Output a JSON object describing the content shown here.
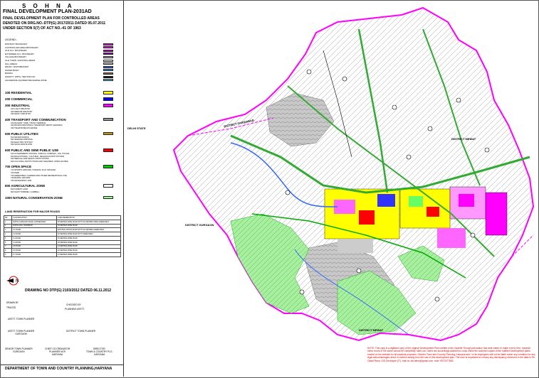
{
  "title": {
    "name": "S O H N A",
    "plan": "FINAL DEVELOPMENT PLAN-2031AD",
    "line1": "FINAL DEVELOPMENT PLAN FOR CONTROLLED AREAS",
    "line2": "DENOTED ON DRG.NO.-DTP(G) 2017/2011 DATED 05.07.2011",
    "line3": "UNDER SECTION 5(7) OF ACT NO.-41 OF 1963"
  },
  "legend": {
    "heading": "LEGEND:-",
    "boundaries": [
      {
        "label": "DISTRICT BOUNDARY",
        "color": "#ff00ff"
      },
      {
        "label": "CONTROLLED AREA BOUNDARY",
        "color": "#ff00ff"
      },
      {
        "label": "OLD M.C. BOUNDARY",
        "color": "#cc00cc"
      },
      {
        "label": "EXTENDED M.C. BOUNDARY",
        "color": "#9900cc"
      },
      {
        "label": "VILLAGE BOUNDARY",
        "color": "#aaaaaa"
      },
      {
        "label": "OLD TOWN / EXISTING ABADI",
        "color": "#ffffff"
      },
      {
        "label": "HILL AREAS",
        "color": "#cfcfcf"
      },
      {
        "label": "DRAIN / DISTRIBUTARY",
        "color": "#3366ff"
      },
      {
        "label": "WATER BODY",
        "color": "#3399ff"
      },
      {
        "label": "BUNDH",
        "color": "#996633"
      },
      {
        "label": "GRAVITY (PPS) / SECTOR NO.",
        "color": "#000000"
      },
      {
        "label": "AGGRESIVE AQUIFER RECHARGE ZONE",
        "color": "#66ccff"
      }
    ],
    "zones": [
      {
        "label": "100  RESIDENTIAL",
        "color": "#ffff00",
        "subs": []
      },
      {
        "label": "200  COMMERCIAL",
        "color": "#0000ff",
        "subs": []
      },
      {
        "label": "300  INDUSTRIAL",
        "color": "#ff00ff",
        "subs": [
          "310  LIGHT INDUSTRY",
          "320  MEDIUM INDUSTRY",
          "330  HEAVY INDUSTRY"
        ]
      },
      {
        "label": "400  TRANSPORT AND COMMUNICATION",
        "color": "#999999",
        "subs": [
          "410  RAILWAY YARD, TRUCK TERMINAL",
          "420  ROADS INDUSTRIAL TRANSPORT DEPOT (HEAVIES)",
          "430  TELEPHONE EXCHANGE"
        ]
      },
      {
        "label": "500  PUBLIC UTILITIES",
        "color": "#cc9900",
        "subs": [
          "510  WATER WORKS",
          "520  SEWAGE DISPOSAL",
          "530  ELECTRIC STATION",
          "540  SOLID WASTE SITE"
        ]
      },
      {
        "label": "600  PUBLIC AND SEMI PUBLIC USE",
        "color": "#ff0000",
        "subs": [
          "610  GOVERNMENT OFFICES, JUDICIAL COMPLEX, JAIL, POLICE",
          "620  EDUCATIONAL, CULTURAL, RELIGIOUS INSTITUTIONS",
          "630  MEDICAL AND HEALTH INSTITUTIONS",
          "640  CULTURAL INSTITUTIONS AND THEATRES, OPEN HOUSES"
        ]
      },
      {
        "label": "700  OPEN SPACE",
        "color": "#00cc00",
        "subs": [
          "710  SPORTS GROUND, STADIUM, PLAY GROUND",
          "720  PARK",
          "730  GREEN BELT, GARDEN AND OTHER RECREATIONAL USE",
          "740  BURIAL GROUND",
          "750  WATER BODY AND"
        ]
      },
      {
        "label": "800  AGRICULTURAL ZONE",
        "color": "#ffffff",
        "subs": [
          "810  FOREST LAND",
          "820  SHIFT TURBINE / GUMBALL"
        ]
      },
      {
        "label": "1000  NATURAL CONSERVATION ZONE",
        "color": "#99ff99",
        "subs": []
      }
    ]
  },
  "road_table": {
    "title": "LAND RESERVATION FOR MAJOR ROADS",
    "rows": [
      [
        "SR.",
        "CLASSIFICATION",
        "LAND RESERVATION"
      ],
      [
        "1",
        "SOHNA GURGAON ROAD, EXPRESSWAY",
        "60 METRES WIDE ROAD WITH 100 METRES WIDE GREEN BELT"
      ],
      [
        "2",
        "SOHNA PALI CORRIDOR",
        "60 METRES WIDE ROAD"
      ],
      [
        "3",
        "V-1 ROAD",
        "EXISTING SOHNA ROAD WITH 100 METRES GREEN BELT"
      ],
      [
        "4",
        "V-2 ROAD",
        "60 METRES WIDE ROAD WITH GREEN BELT"
      ],
      [
        "5",
        "V-3 ROAD",
        "45 METRES WIDE ROAD"
      ],
      [
        "6",
        "V-4 ROAD",
        "30 METRES WIDE ROAD"
      ],
      [
        "7",
        "V-5 ROAD",
        "24 METRES WIDE ROAD"
      ],
      [
        "8",
        "V-6 ROAD",
        "18 METRES WIDE ROAD"
      ],
      [
        "9",
        "V-7 ROAD",
        "12 METRES WIDE ROAD"
      ]
    ]
  },
  "drawing_no": "DRAWING NO DTP(G) 2103/2012 DATED 06.11.2012",
  "signatures": {
    "drawn_by": "DRAWN BY",
    "traced": "TRACED",
    "checked_by": "CHECKED BY",
    "planning_asstt": "PLANNING ASSTT.",
    "asstt_tp": "ASSTT. TOWN PLANNER",
    "asstt_tp_gurgaon": "ASSTT. TOWN PLANNER\nGURGAON",
    "district_tp": "DISTRICT TOWN PLANNER",
    "senior_tp": "SENIOR TOWN PLANNER\nGURGAON",
    "chief_coordinator": "CHIEF CO-ORDINATOR\nPLANNER NCR\nHARYANA",
    "director": "DIRECTOR,\nTOWN & COUNTRY PLG.\nHARYANA"
  },
  "department": "DEPARTMENT OF TOWN AND COUNTRY PLANNING,HARYANA",
  "map_labels": {
    "delhi_state": "DELHI STATE",
    "district_faridabad": "DISTRICT FARIDABAD",
    "district_mewat_top": "DISTRICT MEWAT",
    "district_gurgaon": "DISTRICT GURGAON",
    "district_mewat_bottom": "DISTRICT MEWAT",
    "north": "N"
  },
  "note": "NOTE: This copy is a digitized copy of the original Development Plan notified in the Gazette Though precaution has been taken to make it error free, however minor errors in the same cannot be completely ruled out. Users are accordingly advised to cross check the scanned copies of the notified Development plans hosted on the website for all practical purposes. Director Town and Country Planning, Haryana and / or its employees will not be liable under any condition for any legal action/damages direct or indirect arising from the use of this development plan. The user is requested to convey any discrepancy observed in the data to Sh. Obaid Rana, GIS Developer (IT), mail at: obr.aiims@gmail.com, mob: 9972477682."
}
